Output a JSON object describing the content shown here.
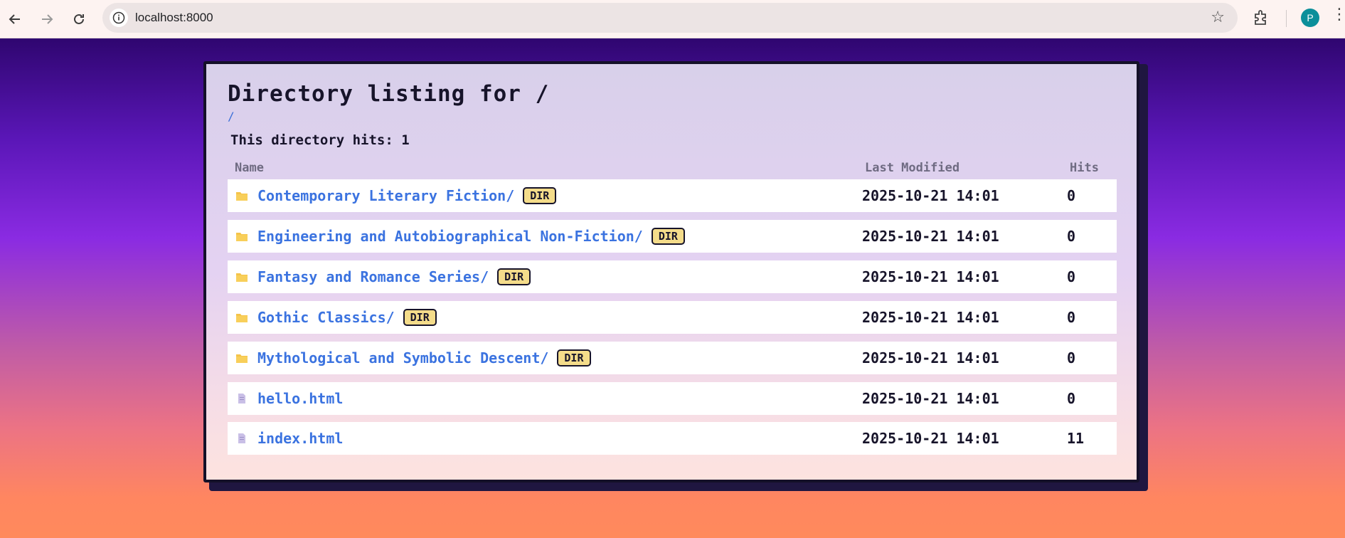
{
  "browser": {
    "url": "localhost:8000",
    "profile_initial": "P",
    "icons": {
      "back": "arrow-left-icon",
      "forward": "arrow-right-icon",
      "reload": "reload-icon",
      "site_info": "info-icon",
      "bookmark": "star-icon",
      "extensions": "puzzle-icon",
      "menu": "kebab-menu-icon"
    }
  },
  "listing": {
    "title": "Directory listing for /",
    "breadcrumb": "/",
    "hits_text": "This directory hits: 1",
    "columns": {
      "name": "Name",
      "modified": "Last Modified",
      "hits": "Hits"
    },
    "dir_badge": "DIR",
    "entries": [
      {
        "name": "Contemporary Literary Fiction/",
        "type": "dir",
        "modified": "2025-10-21 14:01",
        "hits": "0"
      },
      {
        "name": "Engineering and Autobiographical Non-Fiction/",
        "type": "dir",
        "modified": "2025-10-21 14:01",
        "hits": "0"
      },
      {
        "name": "Fantasy and Romance Series/",
        "type": "dir",
        "modified": "2025-10-21 14:01",
        "hits": "0"
      },
      {
        "name": "Gothic Classics/",
        "type": "dir",
        "modified": "2025-10-21 14:01",
        "hits": "0"
      },
      {
        "name": "Mythological and Symbolic Descent/",
        "type": "dir",
        "modified": "2025-10-21 14:01",
        "hits": "0"
      },
      {
        "name": "hello.html",
        "type": "file",
        "modified": "2025-10-21 14:01",
        "hits": "0"
      },
      {
        "name": "index.html",
        "type": "file",
        "modified": "2025-10-21 14:01",
        "hits": "11"
      }
    ]
  },
  "colors": {
    "link": "#3b73e0",
    "badge_bg": "#f4dc8a",
    "folder": "#f5c44a",
    "file": "#c9bfe6",
    "card_border": "#141028"
  }
}
